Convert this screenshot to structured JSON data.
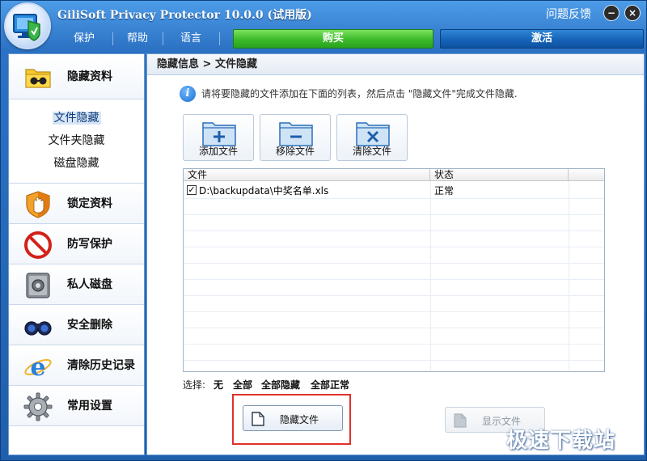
{
  "window": {
    "title": "GiliSoft Privacy Protector 10.0.0 (试用版)",
    "feedback": "问题反馈",
    "minimize_glyph": "−",
    "close_glyph": "×"
  },
  "menu": {
    "items": [
      {
        "label": "保护"
      },
      {
        "label": "帮助"
      },
      {
        "label": "语言"
      }
    ],
    "buy_label": "购买",
    "activate_label": "激活",
    "buy_color": "#3cba2a",
    "activate_color": "#1663b8"
  },
  "sidebar": {
    "hide_data": {
      "label": "隐藏资料",
      "icon": "folder-glasses-icon"
    },
    "sub_items": [
      {
        "label": "文件隐藏",
        "selected": true
      },
      {
        "label": "文件夹隐藏"
      },
      {
        "label": "磁盘隐藏"
      }
    ],
    "items": [
      {
        "label": "锁定资料",
        "icon": "shield-hand-icon"
      },
      {
        "label": "防写保护",
        "icon": "no-entry-icon"
      },
      {
        "label": "私人磁盘",
        "icon": "safe-icon"
      },
      {
        "label": "安全删除",
        "icon": "binoculars-icon"
      },
      {
        "label": "清除历史记录",
        "icon": "internet-explorer-icon"
      },
      {
        "label": "常用设置",
        "icon": "gear-icon"
      }
    ]
  },
  "main": {
    "breadcrumb": "隐藏信息 > 文件隐藏",
    "info_text": "请将要隐藏的文件添加在下面的列表，然后点击 \"隐藏文件\"完成文件隐藏.",
    "toolbar": {
      "add_label": "添加文件",
      "remove_label": "移除文件",
      "clear_label": "清除文件"
    },
    "table": {
      "columns": [
        "文件",
        "状态",
        ""
      ],
      "rows": [
        {
          "checked": true,
          "file": "D:\\backupdata\\中奖名单.xls",
          "status": "正常"
        }
      ]
    },
    "select": {
      "label": "选择:",
      "options": [
        "无",
        "全部",
        "全部隐藏",
        "全部正常"
      ]
    },
    "hide_file_label": "隐藏文件",
    "show_file_label": "显示文件",
    "show_file_enabled": false
  },
  "watermark": "极速下载站"
}
